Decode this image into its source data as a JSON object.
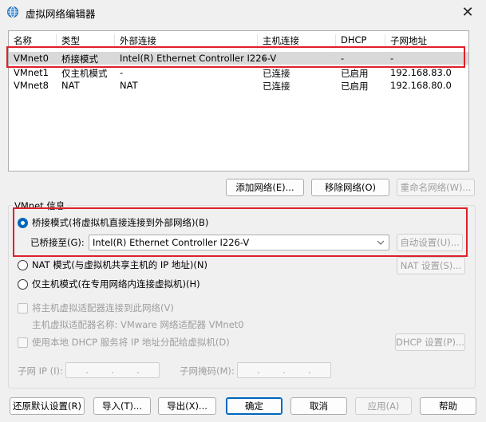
{
  "window": {
    "title": "虚拟网络编辑器",
    "close_glyph": "✕"
  },
  "network_list": {
    "columns": [
      "名称",
      "类型",
      "外部连接",
      "主机连接",
      "DHCP",
      "子网地址"
    ],
    "rows": [
      [
        "VMnet0",
        "桥接模式",
        "Intel(R) Ethernet Controller I226-V",
        "-",
        "-",
        "-"
      ],
      [
        "VMnet1",
        "仅主机模式",
        "-",
        "已连接",
        "已启用",
        "192.168.83.0"
      ],
      [
        "VMnet8",
        "NAT",
        "NAT",
        "已连接",
        "已启用",
        "192.168.80.0"
      ]
    ],
    "selected_row": 0
  },
  "list_buttons": {
    "add": "添加网络(E)...",
    "remove": "移除网络(O)",
    "rename": "重命名网络(W)..."
  },
  "vmnet_info": {
    "legend": "VMnet 信息",
    "bridged_label": "桥接模式(将虚拟机直接连接到外部网络)(B)",
    "bridged_to_label": "已桥接至(G):",
    "bridged_to_value": "Intel(R) Ethernet Controller I226-V",
    "auto_settings": "自动设置(U)...",
    "nat_label": "NAT 模式(与虚拟机共享主机的 IP 地址)(N)",
    "nat_settings": "NAT 设置(S)...",
    "hostonly_label": "仅主机模式(在专用网络内连接虚拟机)(H)",
    "connect_adapter_label": "将主机虚拟适配器连接到此网络(V)",
    "adapter_name_label": "主机虚拟适配器名称: VMware 网络适配器 VMnet0",
    "dhcp_label": "使用本地 DHCP 服务将 IP 地址分配给虚拟机(D)",
    "dhcp_settings": "DHCP 设置(P)...",
    "subnet_ip_label": "子网 IP (I):",
    "subnet_mask_label": "子网掩码(M):",
    "ip_dots": [
      ".",
      ".",
      "."
    ],
    "mask_dots": [
      ".",
      ".",
      "."
    ]
  },
  "bottom_buttons": {
    "restore": "还原默认设置(R)",
    "import": "导入(T)...",
    "export": "导出(X)...",
    "ok": "确定",
    "cancel": "取消",
    "apply": "应用(A)",
    "help": "帮助"
  },
  "colors": {
    "highlight": "#e0202a",
    "accent": "#0067c0"
  }
}
